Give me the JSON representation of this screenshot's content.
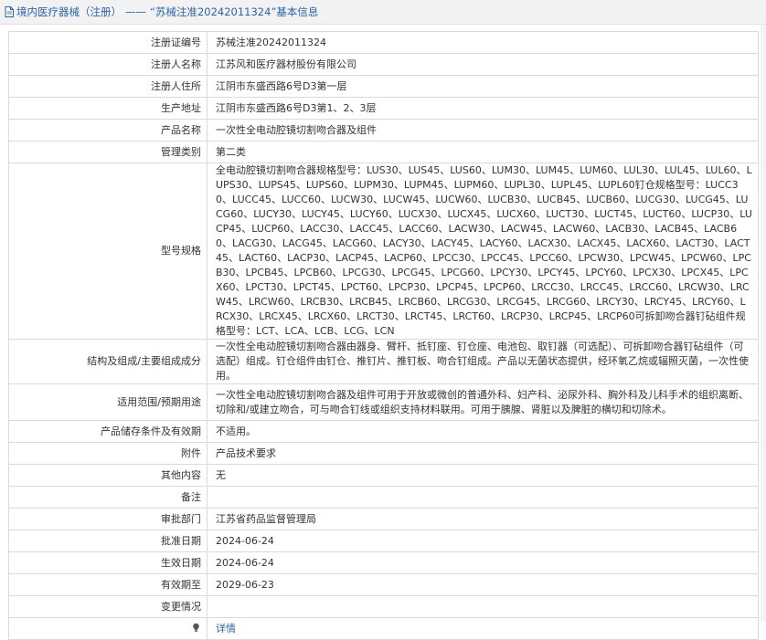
{
  "breadcrumb": {
    "section": "境内医疗器械（注册）",
    "separator": "——",
    "title": "“苏械注准20242011324”基本信息"
  },
  "rows": [
    {
      "label": "注册证编号",
      "value": "苏械注准20242011324"
    },
    {
      "label": "注册人名称",
      "value": "江苏风和医疗器材股份有限公司"
    },
    {
      "label": "注册人住所",
      "value": "江阴市东盛西路6号D3第一层"
    },
    {
      "label": "生产地址",
      "value": "江阴市东盛西路6号D3第1、2、3层"
    },
    {
      "label": "产品名称",
      "value": "一次性全电动腔镜切割吻合器及组件"
    },
    {
      "label": "管理类别",
      "value": "第二类"
    },
    {
      "label": "型号规格",
      "value": "全电动腔镜切割吻合器规格型号：LUS30、LUS45、LUS60、LUM30、LUM45、LUM60、LUL30、LUL45、LUL60、LUPS30、LUPS45、LUPS60、LUPM30、LUPM45、LUPM60、LUPL30、LUPL45、LUPL60钉仓规格型号：LUCC30、LUCC45、LUCC60、LUCW30、LUCW45、LUCW60、LUCB30、LUCB45、LUCB60、LUCG30、LUCG45、LUCG60、LUCY30、LUCY45、LUCY60、LUCX30、LUCX45、LUCX60、LUCT30、LUCT45、LUCT60、LUCP30、LUCP45、LUCP60、LACC30、LACC45、LACC60、LACW30、LACW45、LACW60、LACB30、LACB45、LACB60、LACG30、LACG45、LACG60、LACY30、LACY45、LACY60、LACX30、LACX45、LACX60、LACT30、LACT45、LACT60、LACP30、LACP45、LACP60、LPCC30、LPCC45、LPCC60、LPCW30、LPCW45、LPCW60、LPCB30、LPCB45、LPCB60、LPCG30、LPCG45、LPCG60、LPCY30、LPCY45、LPCY60、LPCX30、LPCX45、LPCX60、LPCT30、LPCT45、LPCT60、LPCP30、LPCP45、LPCP60、LRCC30、LRCC45、LRCC60、LRCW30、LRCW45、LRCW60、LRCB30、LRCB45、LRCB60、LRCG30、LRCG45、LRCG60、LRCY30、LRCY45、LRCY60、LRCX30、LRCX45、LRCX60、LRCT30、LRCT45、LRCT60、LRCP30、LRCP45、LRCP60可拆卸吻合器钉砧组件规格型号：LCT、LCA、LCB、LCG、LCN"
    },
    {
      "label": "结构及组成/主要组成成分",
      "value": "一次性全电动腔镜切割吻合器由器身、臂杆、抵钉座、钉仓座、电池包、取钉器（可选配）、可拆卸吻合器钉砧组件（可选配）组成。钉仓组件由钉仓、推钉片、推钉板、吻合钉组成。产品以无菌状态提供，经环氧乙烷或辐照灭菌，一次性使用。"
    },
    {
      "label": "适用范围/预期用途",
      "value": "一次性全电动腔镜切割吻合器及组件可用于开放或微创的普通外科、妇产科、泌尿外科、胸外科及儿科手术的组织离断、切除和/或建立吻合，可与吻合钉线或组织支持材料联用。可用于胰腺、肾脏以及脾脏的横切和切除术。"
    },
    {
      "label": "产品储存条件及有效期",
      "value": "不适用。"
    },
    {
      "label": "附件",
      "value": "产品技术要求"
    },
    {
      "label": "其他内容",
      "value": "无"
    },
    {
      "label": "备注",
      "value": ""
    },
    {
      "label": "审批部门",
      "value": "江苏省药品监督管理局"
    },
    {
      "label": "批准日期",
      "value": "2024-06-24"
    },
    {
      "label": "生效日期",
      "value": "2024-06-24"
    },
    {
      "label": "有效期至",
      "value": "2029-06-23"
    },
    {
      "label": "变更情况",
      "value": ""
    }
  ],
  "footer_row": {
    "link_text": "详情"
  }
}
